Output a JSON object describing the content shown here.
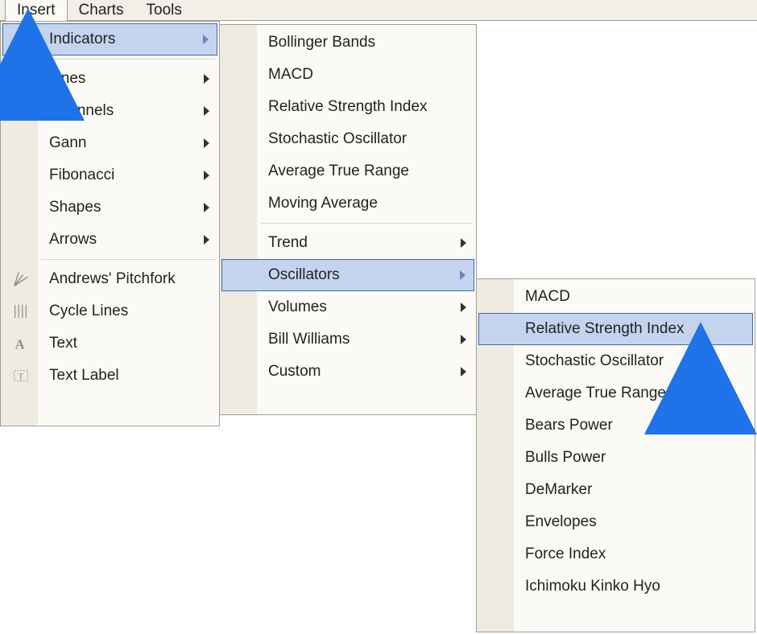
{
  "menubar": {
    "items": [
      {
        "label": "Insert",
        "active": true
      },
      {
        "label": "Charts",
        "active": false
      },
      {
        "label": "Tools",
        "active": false
      }
    ]
  },
  "level1": {
    "items": [
      {
        "label": "Indicators",
        "hasArrow": true,
        "selected": true
      },
      {
        "sep": true
      },
      {
        "label": "Lines",
        "hasArrow": true
      },
      {
        "label": "Channels",
        "hasArrow": true
      },
      {
        "label": "Gann",
        "hasArrow": true
      },
      {
        "label": "Fibonacci",
        "hasArrow": true
      },
      {
        "label": "Shapes",
        "hasArrow": true
      },
      {
        "label": "Arrows",
        "hasArrow": true
      },
      {
        "sep": true
      },
      {
        "label": "Andrews' Pitchfork",
        "icon": "pitchfork"
      },
      {
        "label": "Cycle Lines",
        "icon": "cycle"
      },
      {
        "label": "Text",
        "icon": "text-a"
      },
      {
        "label": "Text Label",
        "icon": "text-label"
      }
    ]
  },
  "level2": {
    "items": [
      {
        "label": "Bollinger Bands"
      },
      {
        "label": "MACD"
      },
      {
        "label": "Relative Strength Index"
      },
      {
        "label": "Stochastic Oscillator"
      },
      {
        "label": "Average True Range"
      },
      {
        "label": "Moving Average"
      },
      {
        "sep": true
      },
      {
        "label": "Trend",
        "hasArrow": true
      },
      {
        "label": "Oscillators",
        "hasArrow": true,
        "selected": true
      },
      {
        "label": "Volumes",
        "hasArrow": true
      },
      {
        "label": "Bill Williams",
        "hasArrow": true
      },
      {
        "label": "Custom",
        "hasArrow": true
      }
    ]
  },
  "level3": {
    "items": [
      {
        "label": "MACD"
      },
      {
        "label": "Relative Strength Index",
        "selected": true
      },
      {
        "label": "Stochastic Oscillator"
      },
      {
        "label": "Average True Range"
      },
      {
        "label": "Bears Power"
      },
      {
        "label": "Bulls Power"
      },
      {
        "label": "DeMarker"
      },
      {
        "label": "Envelopes"
      },
      {
        "label": "Force Index"
      },
      {
        "label": "Ichimoku Kinko Hyo"
      }
    ]
  }
}
